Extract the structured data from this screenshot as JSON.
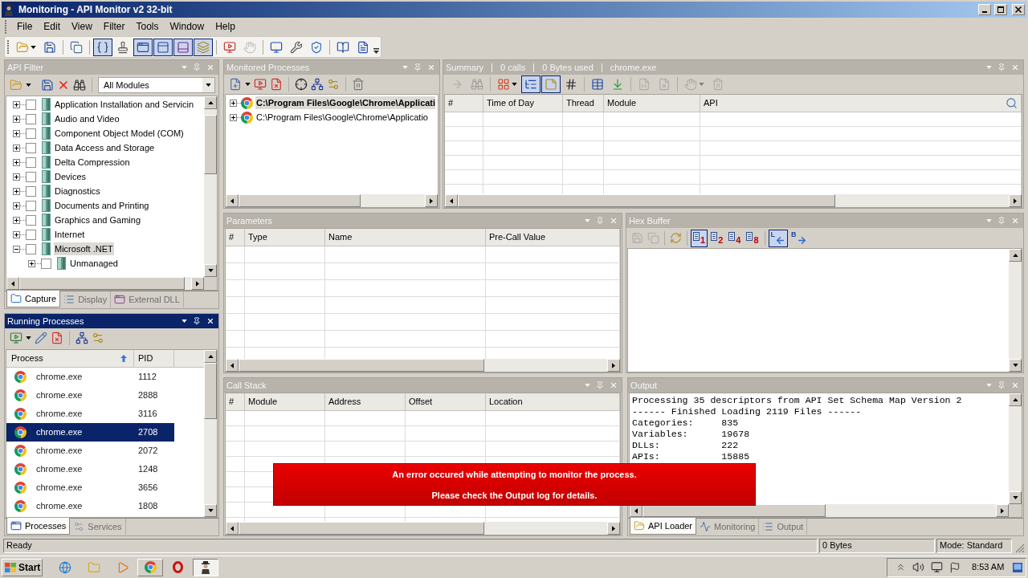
{
  "window": {
    "title": "Monitoring - API Monitor v2 32-bit"
  },
  "menu": [
    "File",
    "Edit",
    "View",
    "Filter",
    "Tools",
    "Window",
    "Help"
  ],
  "toolbar": [
    {
      "pressed": false,
      "disabled": false
    },
    {
      "pressed": false,
      "disabled": false
    },
    {
      "pressed": false,
      "disabled": false
    },
    {
      "pressed": true,
      "disabled": false
    },
    {
      "pressed": false,
      "disabled": false
    },
    {
      "pressed": true,
      "disabled": false
    },
    {
      "pressed": true,
      "disabled": false
    },
    {
      "pressed": true,
      "disabled": false
    },
    {
      "pressed": true,
      "disabled": false
    },
    {
      "pressed": false,
      "disabled": false
    },
    {
      "pressed": false,
      "disabled": true
    },
    {
      "pressed": false,
      "disabled": false
    },
    {
      "pressed": false,
      "disabled": false
    },
    {
      "pressed": false,
      "disabled": false
    },
    {
      "pressed": false,
      "disabled": false
    },
    {
      "pressed": false,
      "disabled": false
    }
  ],
  "api_filter": {
    "title": "API Filter",
    "active": false,
    "module_select": {
      "value": "All Modules"
    },
    "tree": [
      {
        "label": "Application Installation and Servicin",
        "checked": false,
        "expanded": false,
        "selected": false
      },
      {
        "label": "Audio and Video",
        "checked": false,
        "expanded": false,
        "selected": false
      },
      {
        "label": "Component Object Model (COM)",
        "checked": false,
        "expanded": false,
        "selected": false
      },
      {
        "label": "Data Access and Storage",
        "checked": false,
        "expanded": false,
        "selected": false
      },
      {
        "label": "Delta Compression",
        "checked": false,
        "expanded": false,
        "selected": false
      },
      {
        "label": "Devices",
        "checked": false,
        "expanded": false,
        "selected": false
      },
      {
        "label": "Diagnostics",
        "checked": false,
        "expanded": false,
        "selected": false
      },
      {
        "label": "Documents and Printing",
        "checked": false,
        "expanded": false,
        "selected": false
      },
      {
        "label": "Graphics and Gaming",
        "checked": false,
        "expanded": false,
        "selected": false
      },
      {
        "label": "Internet",
        "checked": false,
        "expanded": false,
        "selected": false
      },
      {
        "label": "Microsoft .NET",
        "checked": false,
        "expanded": true,
        "selected": true,
        "children": [
          {
            "label": "Unmanaged",
            "checked": false,
            "expanded": false,
            "selected": false
          }
        ]
      }
    ],
    "tabs": [
      {
        "label": "Capture",
        "selected": true
      },
      {
        "label": "Display",
        "selected": false
      },
      {
        "label": "External DLL",
        "selected": false
      }
    ]
  },
  "running_processes": {
    "title": "Running Processes",
    "active": true,
    "columns": [
      "Process",
      "PID"
    ],
    "rows": [
      {
        "process": "chrome.exe",
        "pid": "1112",
        "selected": false
      },
      {
        "process": "chrome.exe",
        "pid": "2888",
        "selected": false
      },
      {
        "process": "chrome.exe",
        "pid": "3116",
        "selected": false
      },
      {
        "process": "chrome.exe",
        "pid": "2708",
        "selected": true
      },
      {
        "process": "chrome.exe",
        "pid": "2072",
        "selected": false
      },
      {
        "process": "chrome.exe",
        "pid": "1248",
        "selected": false
      },
      {
        "process": "chrome.exe",
        "pid": "3656",
        "selected": false
      },
      {
        "process": "chrome.exe",
        "pid": "1808",
        "selected": false
      }
    ],
    "tabs": [
      {
        "label": "Processes",
        "selected": true
      },
      {
        "label": "Services",
        "selected": false
      }
    ]
  },
  "monitored_processes": {
    "title": "Monitored Processes",
    "active": false,
    "items": [
      {
        "label": "C:\\Program Files\\Google\\Chrome\\Applicati",
        "selected": true,
        "expanded": false
      },
      {
        "label": "C:\\Program Files\\Google\\Chrome\\Applicatio",
        "selected": false,
        "expanded": false
      }
    ]
  },
  "summary": {
    "title_parts": [
      "Summary",
      "0 calls",
      "0 Bytes used",
      "chrome.exe"
    ],
    "active": false,
    "toolbar": [
      {
        "pressed": false,
        "disabled": true
      },
      {
        "pressed": false,
        "disabled": true
      },
      {
        "pressed": false,
        "disabled": false
      },
      {
        "pressed": true,
        "disabled": false
      },
      {
        "pressed": true,
        "disabled": false
      },
      {
        "pressed": false,
        "disabled": false
      },
      {
        "pressed": false,
        "disabled": false
      },
      {
        "pressed": false,
        "disabled": false
      },
      {
        "pressed": false,
        "disabled": true
      },
      {
        "pressed": false,
        "disabled": true
      },
      {
        "pressed": false,
        "disabled": true
      },
      {
        "pressed": false,
        "disabled": true
      }
    ],
    "columns": [
      "#",
      "Time of Day",
      "Thread",
      "Module",
      "API"
    ]
  },
  "parameters": {
    "title": "Parameters",
    "active": false,
    "columns": [
      "#",
      "Type",
      "Name",
      "Pre-Call Value"
    ]
  },
  "hex_buffer": {
    "title": "Hex Buffer",
    "active": false,
    "tools": [
      {
        "disabled": true
      },
      {
        "disabled": true
      },
      {
        "disabled": false
      }
    ],
    "width_buttons": [
      {
        "label": "1",
        "selected": true
      },
      {
        "label": "2",
        "selected": false
      },
      {
        "label": "4",
        "selected": false
      },
      {
        "label": "8",
        "selected": false
      }
    ],
    "order_buttons": [
      {
        "label": "L",
        "selected": true
      },
      {
        "label": "B",
        "selected": false
      }
    ]
  },
  "call_stack": {
    "title": "Call Stack",
    "active": false,
    "columns": [
      "#",
      "Module",
      "Address",
      "Offset",
      "Location"
    ]
  },
  "output": {
    "title": "Output",
    "active": false,
    "lines": [
      "Processing 35 descriptors from API Set Schema Map Version 2",
      "------ Finished Loading 2119 Files ------",
      "Categories:     835",
      "Variables:      19678",
      "DLLs:           222",
      "APIs:           15885"
    ],
    "tabs": [
      {
        "label": "API Loader",
        "selected": true
      },
      {
        "label": "Monitoring",
        "selected": false
      },
      {
        "label": "Output",
        "selected": false
      }
    ]
  },
  "status_bar": {
    "message": "Ready",
    "size": "0 Bytes",
    "mode": "Mode: Standard"
  },
  "error_banner": {
    "lines": [
      "An error occured while attempting to monitor the process.",
      "Please check the Output log for details."
    ]
  },
  "taskbar": {
    "start_label": "Start",
    "window_buttons": [
      {
        "selected": false
      },
      {
        "selected": true
      }
    ],
    "clock": "8:53 AM"
  }
}
